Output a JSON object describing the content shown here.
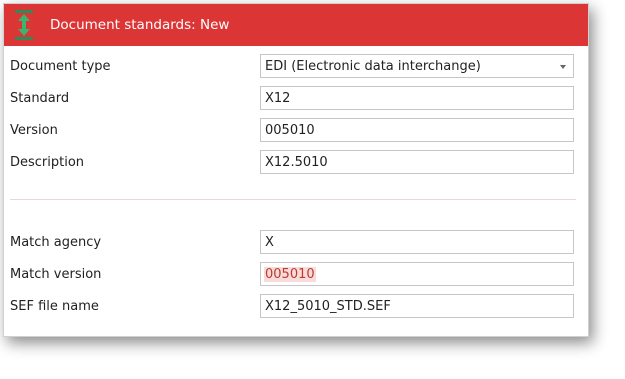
{
  "window": {
    "title": "Document standards: New",
    "accent_color": "#dc3535",
    "icon": "vertical-resize-arrow-icon"
  },
  "form": {
    "document_type": {
      "label": "Document type",
      "value": "EDI (Electronic data interchange)",
      "control": "dropdown"
    },
    "standard": {
      "label": "Standard",
      "value": "X12"
    },
    "version": {
      "label": "Version",
      "value": "005010"
    },
    "description": {
      "label": "Description",
      "value": "X12.5010"
    },
    "match_agency": {
      "label": "Match agency",
      "value": "X"
    },
    "match_version": {
      "label": "Match version",
      "value": "005010",
      "highlighted": true
    },
    "sef_file_name": {
      "label": "SEF file name",
      "value": "X12_5010_STD.SEF"
    }
  }
}
